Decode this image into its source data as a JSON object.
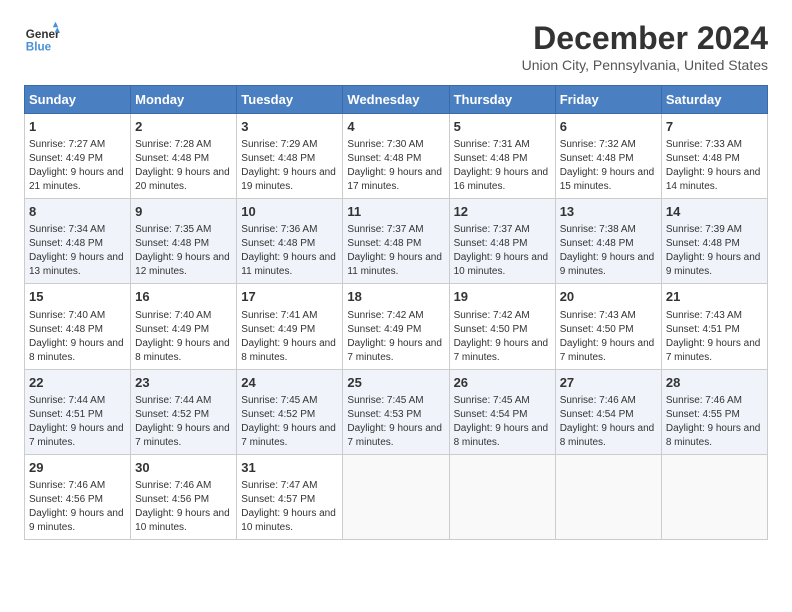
{
  "logo": {
    "line1": "General",
    "line2": "Blue"
  },
  "title": "December 2024",
  "subtitle": "Union City, Pennsylvania, United States",
  "headers": [
    "Sunday",
    "Monday",
    "Tuesday",
    "Wednesday",
    "Thursday",
    "Friday",
    "Saturday"
  ],
  "weeks": [
    [
      {
        "day": "1",
        "sunrise": "7:27 AM",
        "sunset": "4:49 PM",
        "daylight": "9 hours and 21 minutes."
      },
      {
        "day": "2",
        "sunrise": "7:28 AM",
        "sunset": "4:48 PM",
        "daylight": "9 hours and 20 minutes."
      },
      {
        "day": "3",
        "sunrise": "7:29 AM",
        "sunset": "4:48 PM",
        "daylight": "9 hours and 19 minutes."
      },
      {
        "day": "4",
        "sunrise": "7:30 AM",
        "sunset": "4:48 PM",
        "daylight": "9 hours and 17 minutes."
      },
      {
        "day": "5",
        "sunrise": "7:31 AM",
        "sunset": "4:48 PM",
        "daylight": "9 hours and 16 minutes."
      },
      {
        "day": "6",
        "sunrise": "7:32 AM",
        "sunset": "4:48 PM",
        "daylight": "9 hours and 15 minutes."
      },
      {
        "day": "7",
        "sunrise": "7:33 AM",
        "sunset": "4:48 PM",
        "daylight": "9 hours and 14 minutes."
      }
    ],
    [
      {
        "day": "8",
        "sunrise": "7:34 AM",
        "sunset": "4:48 PM",
        "daylight": "9 hours and 13 minutes."
      },
      {
        "day": "9",
        "sunrise": "7:35 AM",
        "sunset": "4:48 PM",
        "daylight": "9 hours and 12 minutes."
      },
      {
        "day": "10",
        "sunrise": "7:36 AM",
        "sunset": "4:48 PM",
        "daylight": "9 hours and 11 minutes."
      },
      {
        "day": "11",
        "sunrise": "7:37 AM",
        "sunset": "4:48 PM",
        "daylight": "9 hours and 11 minutes."
      },
      {
        "day": "12",
        "sunrise": "7:37 AM",
        "sunset": "4:48 PM",
        "daylight": "9 hours and 10 minutes."
      },
      {
        "day": "13",
        "sunrise": "7:38 AM",
        "sunset": "4:48 PM",
        "daylight": "9 hours and 9 minutes."
      },
      {
        "day": "14",
        "sunrise": "7:39 AM",
        "sunset": "4:48 PM",
        "daylight": "9 hours and 9 minutes."
      }
    ],
    [
      {
        "day": "15",
        "sunrise": "7:40 AM",
        "sunset": "4:48 PM",
        "daylight": "9 hours and 8 minutes."
      },
      {
        "day": "16",
        "sunrise": "7:40 AM",
        "sunset": "4:49 PM",
        "daylight": "9 hours and 8 minutes."
      },
      {
        "day": "17",
        "sunrise": "7:41 AM",
        "sunset": "4:49 PM",
        "daylight": "9 hours and 8 minutes."
      },
      {
        "day": "18",
        "sunrise": "7:42 AM",
        "sunset": "4:49 PM",
        "daylight": "9 hours and 7 minutes."
      },
      {
        "day": "19",
        "sunrise": "7:42 AM",
        "sunset": "4:50 PM",
        "daylight": "9 hours and 7 minutes."
      },
      {
        "day": "20",
        "sunrise": "7:43 AM",
        "sunset": "4:50 PM",
        "daylight": "9 hours and 7 minutes."
      },
      {
        "day": "21",
        "sunrise": "7:43 AM",
        "sunset": "4:51 PM",
        "daylight": "9 hours and 7 minutes."
      }
    ],
    [
      {
        "day": "22",
        "sunrise": "7:44 AM",
        "sunset": "4:51 PM",
        "daylight": "9 hours and 7 minutes."
      },
      {
        "day": "23",
        "sunrise": "7:44 AM",
        "sunset": "4:52 PM",
        "daylight": "9 hours and 7 minutes."
      },
      {
        "day": "24",
        "sunrise": "7:45 AM",
        "sunset": "4:52 PM",
        "daylight": "9 hours and 7 minutes."
      },
      {
        "day": "25",
        "sunrise": "7:45 AM",
        "sunset": "4:53 PM",
        "daylight": "9 hours and 7 minutes."
      },
      {
        "day": "26",
        "sunrise": "7:45 AM",
        "sunset": "4:54 PM",
        "daylight": "9 hours and 8 minutes."
      },
      {
        "day": "27",
        "sunrise": "7:46 AM",
        "sunset": "4:54 PM",
        "daylight": "9 hours and 8 minutes."
      },
      {
        "day": "28",
        "sunrise": "7:46 AM",
        "sunset": "4:55 PM",
        "daylight": "9 hours and 8 minutes."
      }
    ],
    [
      {
        "day": "29",
        "sunrise": "7:46 AM",
        "sunset": "4:56 PM",
        "daylight": "9 hours and 9 minutes."
      },
      {
        "day": "30",
        "sunrise": "7:46 AM",
        "sunset": "4:56 PM",
        "daylight": "9 hours and 10 minutes."
      },
      {
        "day": "31",
        "sunrise": "7:47 AM",
        "sunset": "4:57 PM",
        "daylight": "9 hours and 10 minutes."
      },
      null,
      null,
      null,
      null
    ]
  ]
}
